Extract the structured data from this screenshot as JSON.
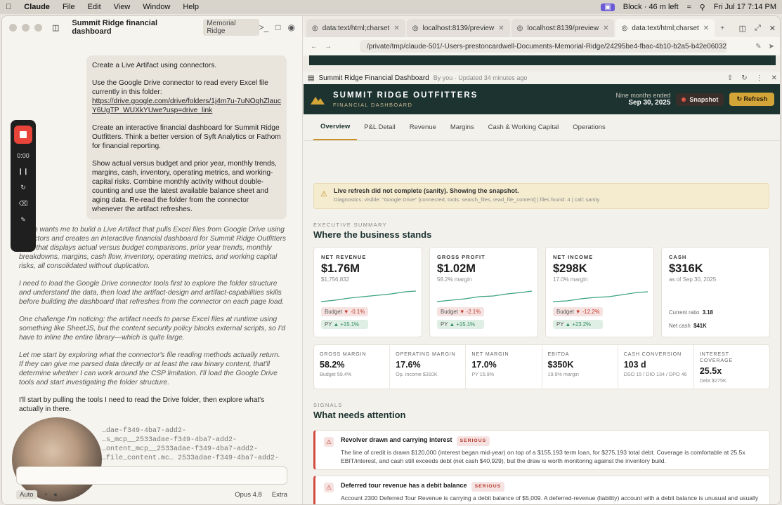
{
  "menubar": {
    "app": "Claude",
    "items": [
      "File",
      "Edit",
      "View",
      "Window",
      "Help"
    ],
    "timer": "Block · 46 m left",
    "datetime": "Fri Jul 17  7:14 PM"
  },
  "window": {
    "title": "Summit Ridge financial dashboard",
    "project": "Memorial Ridge"
  },
  "user_message": {
    "p1": "Create a Live Artifact using connectors.",
    "p2": "Use the Google Drive connector to read every Excel file currently in this folder:",
    "link": "https://drive.google.com/drive/folders/1j4m7u-7uNOqhZlaucY6UgTP_WUXkYUwe?usp=drive_link",
    "p3": "Create an interactive financial dashboard for Summit Ridge Outfitters. Think a better version of Syft Analytics or Fathom for financial reporting.",
    "p4": "Show actual versus budget and prior year, monthly trends, margins, cash, inventory, operating metrics, and working-capital risks. Combine monthly activity without double-counting and use the latest available balance sheet and aging data. Re-read the folder from the connector whenever the artifact refreshes."
  },
  "assistant": {
    "p1": "…son wants me to build a Live Artifact that pulls Excel files from Google Drive using …nectors and creates an interactive financial dashboard for Summit Ridge Outfitters …be that displays actual versus budget comparisons, prior year trends, monthly breakdowns, margins, cash flow, inventory, operating metrics, and working capital risks, all consolidated without duplication.",
    "p2": "I need to load the Google Drive connector tools first to explore the folder structure and understand the data, then load the artifact-design and artifact-capabilities skills before building the dashboard that refreshes from the connector on each page load.",
    "p3": "One challenge I'm noticing: the artifact needs to parse Excel files at runtime using something like SheetJS, but the content security policy blocks external scripts, so I'd have to inline the entire library—which is quite large.",
    "p4": "Let me start by exploring what the connector's file reading methods actually return. If they can give me parsed data directly or at least the raw binary content, that'll determine whether I can work around the CSP limitation. I'll load the Google Drive tools and start investigating the folder structure.",
    "p5": "I'll start by pulling the tools I need to read the Drive folder, then explore what's actually in there."
  },
  "recorder": {
    "time": "0:00"
  },
  "toolcalls": {
    "l1": "…dae-f349-4ba7-add2-",
    "l2": "…s_mcp__2533adae-f349-4ba7-add2-",
    "l3": "…ontent_mcp__2533adae-f349-4ba7-add2-",
    "l4": "…file_content.mc…  2533adae-f349-4ba7-add2-"
  },
  "composer": {
    "mode": "Auto",
    "model": "Opus 4.8",
    "effort": "Extra"
  },
  "browser": {
    "tabs": [
      "data:text/html;charset",
      "localhost:8139/preview",
      "localhost:8139/preview",
      "data:text/html;charset"
    ],
    "url": "/private/tmp/claude-501/-Users-prestoncardwell-Documents-Memorial-Ridge/24295be4-fbac-4b10-b2a5-b42e0603216b/scratc…"
  },
  "artifact": {
    "title": "Summit Ridge Financial Dashboard",
    "meta": "By you · Updated 34 minutes ago"
  },
  "dashboard": {
    "brand_name": "SUMMIT RIDGE OUTFITTERS",
    "brand_sub": "FINANCIAL DASHBOARD",
    "period_label": "Nine months ended",
    "period_date": "Sep 30, 2025",
    "snapshot_label": "Snapshot",
    "refresh_label": "Refresh",
    "nav": [
      "Overview",
      "P&L Detail",
      "Revenue",
      "Margins",
      "Cash & Working Capital",
      "Operations"
    ],
    "alert_title": "Live refresh did not complete (sanity). Showing the snapshot.",
    "alert_diag": "Diagnostics: visible: \"Google Drive\" [connected; tools: search_files, read_file_content] | files found: 4 | call: sanity",
    "exec_eyebrow": "EXECUTIVE SUMMARY",
    "exec_title": "Where the business stands",
    "kpis": [
      {
        "label": "NET REVENUE",
        "value": "$1.76M",
        "sub": "$1,756,832",
        "budget": "▼ -0.1%",
        "py": "▲ +15.1%"
      },
      {
        "label": "GROSS PROFIT",
        "value": "$1.02M",
        "sub": "58.2% margin",
        "budget": "▼ -2.1%",
        "py": "▲ +15.1%"
      },
      {
        "label": "NET INCOME",
        "value": "$298K",
        "sub": "17.0% margin",
        "budget": "▼ -12.2%",
        "py": "▲ +23.2%"
      },
      {
        "label": "CASH",
        "value": "$316K",
        "sub": "as of Sep 30, 2025",
        "current_ratio_label": "Current ratio",
        "current_ratio": "3.18",
        "net_cash_label": "Net cash",
        "net_cash": "$41K"
      }
    ],
    "budget_label": "Budget",
    "py_label": "PY",
    "ratios": [
      {
        "label": "GROSS MARGIN",
        "value": "58.2%",
        "sub": "Budget 59.4%"
      },
      {
        "label": "OPERATING MARGIN",
        "value": "17.6%",
        "sub": "Op. income $310K"
      },
      {
        "label": "NET MARGIN",
        "value": "17.0%",
        "sub": "PY 15.9%"
      },
      {
        "label": "EBITDA",
        "value": "$350K",
        "sub": "19.9% margin"
      },
      {
        "label": "CASH CONVERSION",
        "value": "103 d",
        "sub": "DSO 15 / DIO 134 / DPO 46"
      },
      {
        "label": "INTEREST COVERAGE",
        "value": "25.5x",
        "sub": "Debt $275K"
      }
    ],
    "signals_eyebrow": "SIGNALS",
    "signals_title": "What needs attention",
    "signals": [
      {
        "title": "Revolver drawn and carrying interest",
        "badge": "SERIOUS",
        "body": "The line of credit is drawn $120,000 (interest began mid-year) on top of a $155,193 term loan, for $275,193 total debt. Coverage is comfortable at 25.5x EBIT/interest, and cash still exceeds debt (net cash $40,929), but the draw is worth monitoring against the inventory build."
      },
      {
        "title": "Deferred tour revenue has a debit balance",
        "badge": "SERIOUS",
        "body": "Account 2300 Deferred Tour Revenue is carrying a debit balance of $5,009. A deferred-revenue (liability) account with a debit balance is unusual and usually points to over-recognized or mis-posted tour deposits. Small in dollars, worth a look at close."
      }
    ]
  },
  "colors": {
    "accent": "#1c3330",
    "gold": "#d3a437",
    "danger": "#d24b3e",
    "positive": "#2d8a58"
  }
}
